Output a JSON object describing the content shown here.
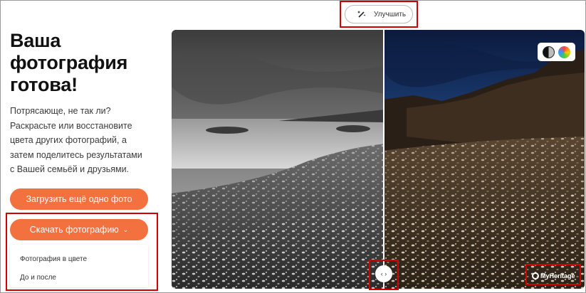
{
  "header": {
    "enhance_label": "Улучшить",
    "enhance_icon": "magic-wand-icon"
  },
  "intro": {
    "title_lines": [
      "Ваша",
      "фотография",
      "готова!"
    ],
    "description_lines": [
      "Потрясающе, не так ли?",
      "Раскрасьте или восстановите",
      "цвета других фотографий, а",
      "затем поделитесь результатами",
      "с Вашей семьёй и друзьями."
    ]
  },
  "actions": {
    "upload_label": "Загрузить ещё одно фото",
    "download_label": "Скачать фотографию",
    "download_caret": "⌄",
    "download_options": [
      "Фотография в цвете",
      "До и после"
    ]
  },
  "viewer": {
    "mode_icons": [
      "black-white-icon",
      "color-wheel-icon"
    ],
    "slider_glyph": "‹ ›",
    "slider_position_fraction": 0.51,
    "watermark": "MyHeritage"
  },
  "colors": {
    "accent": "#f2713f",
    "highlight": "#d40000"
  }
}
